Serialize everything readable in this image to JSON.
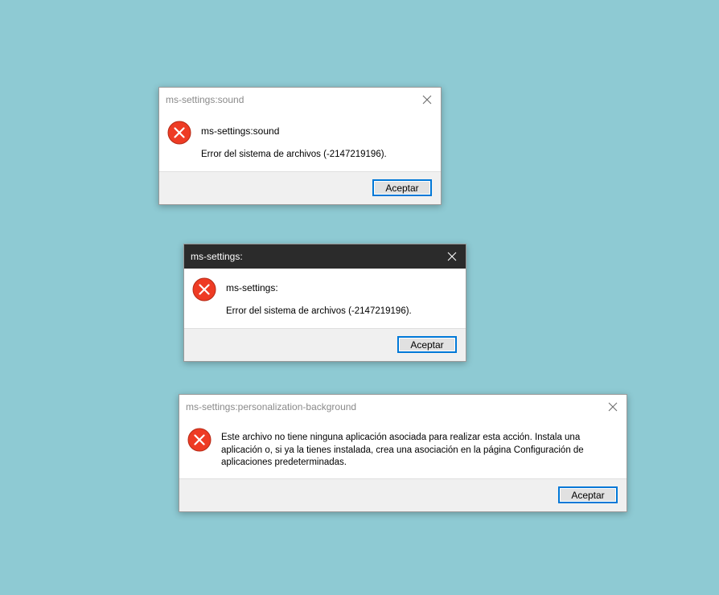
{
  "dialogs": [
    {
      "title": "ms-settings:sound",
      "heading": "ms-settings:sound",
      "message": "Error del sistema de archivos (-2147219196).",
      "button": "Aceptar"
    },
    {
      "title": "ms-settings:",
      "heading": "ms-settings:",
      "message": "Error del sistema de archivos (-2147219196).",
      "button": "Aceptar"
    },
    {
      "title": "ms-settings:personalization-background",
      "message": "Este archivo no tiene ninguna aplicación asociada para realizar esta acción. Instala una aplicación o, si ya la tienes instalada, crea una asociación en la página Configuración de aplicaciones predeterminadas.",
      "button": "Aceptar"
    }
  ],
  "icons": {
    "error": "error-icon",
    "close": "close-icon"
  },
  "colors": {
    "desktop_background": "#8ecad3",
    "error_red": "#ee3b24",
    "accent_blue": "#0078d7",
    "active_titlebar": "#2b2b2b"
  }
}
